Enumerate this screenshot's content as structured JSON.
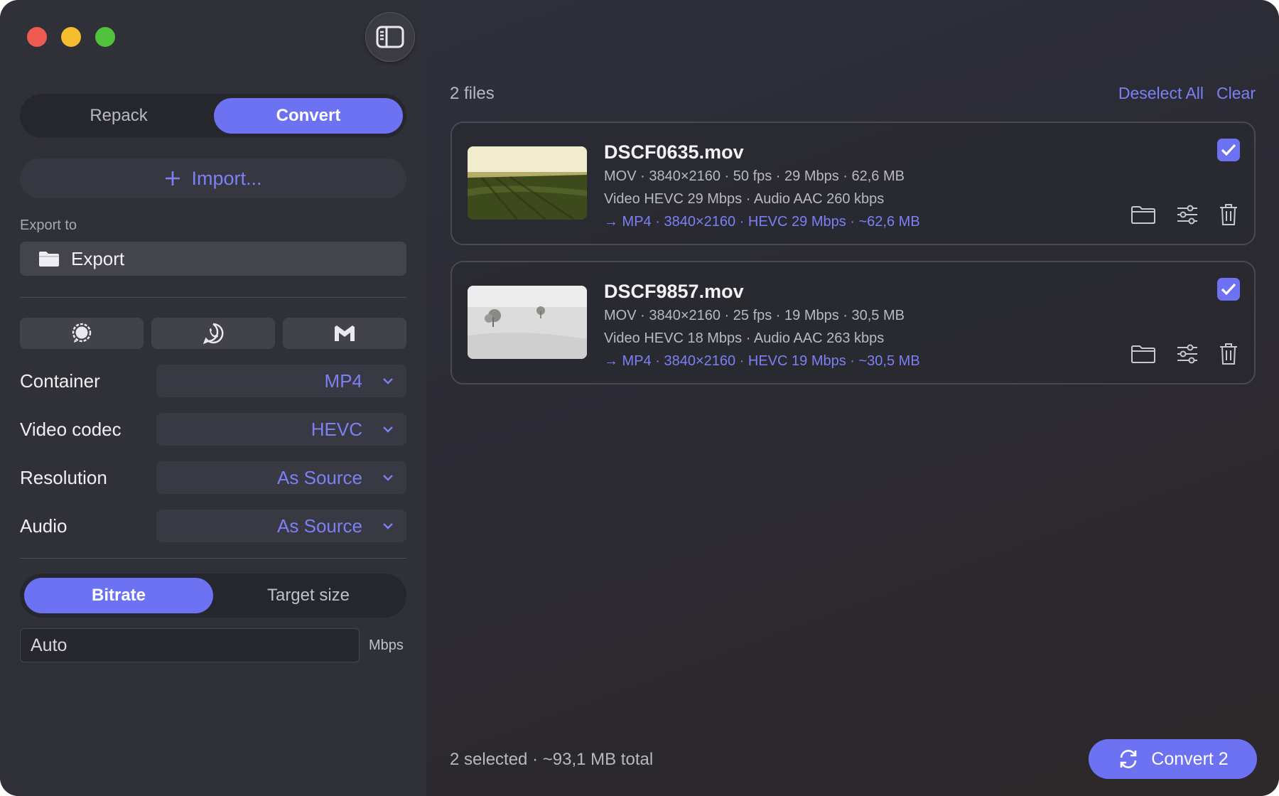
{
  "window": {
    "mode_tabs": [
      "Repack",
      "Convert"
    ],
    "active_mode": "Convert"
  },
  "sidebar": {
    "import_label": "Import...",
    "export_to_label": "Export to",
    "export_folder": "Export",
    "share_icons": [
      "signal-icon",
      "whatsapp-icon",
      "gmail-icon"
    ],
    "options": [
      {
        "label": "Container",
        "value": "MP4"
      },
      {
        "label": "Video codec",
        "value": "HEVC"
      },
      {
        "label": "Resolution",
        "value": "As Source"
      },
      {
        "label": "Audio",
        "value": "As Source"
      }
    ],
    "rate_tabs": [
      "Bitrate",
      "Target size"
    ],
    "active_rate_tab": "Bitrate",
    "bitrate_placeholder": "Auto",
    "bitrate_unit": "Mbps"
  },
  "main": {
    "files_count": "2 files",
    "deselect_all": "Deselect All",
    "clear": "Clear",
    "files": [
      {
        "name": "DSCF0635.mov",
        "meta": "MOV · 3840×2160 · 50 fps · 29 Mbps · 62,6 MB",
        "streams": "Video HEVC 29 Mbps · Audio AAC 260 kbps",
        "target": "→ MP4 · 3840×2160 · HEVC 29 Mbps · ~62,6 MB",
        "checked": true
      },
      {
        "name": "DSCF9857.mov",
        "meta": "MOV · 3840×2160 · 25 fps · 19 Mbps · 30,5 MB",
        "streams": "Video HEVC 18 Mbps · Audio AAC 263 kbps",
        "target": "→ MP4 · 3840×2160 · HEVC 19 Mbps · ~30,5 MB",
        "checked": true
      }
    ],
    "footer_summary": "2 selected · ~93,1 MB total",
    "convert_button": "Convert 2"
  },
  "colors": {
    "accent": "#6d72f2",
    "accent_text": "#7b80f5",
    "sidebar_bg": "#303038",
    "close": "#ee5a52",
    "minimize": "#f4be2f",
    "zoom": "#52c13a"
  }
}
